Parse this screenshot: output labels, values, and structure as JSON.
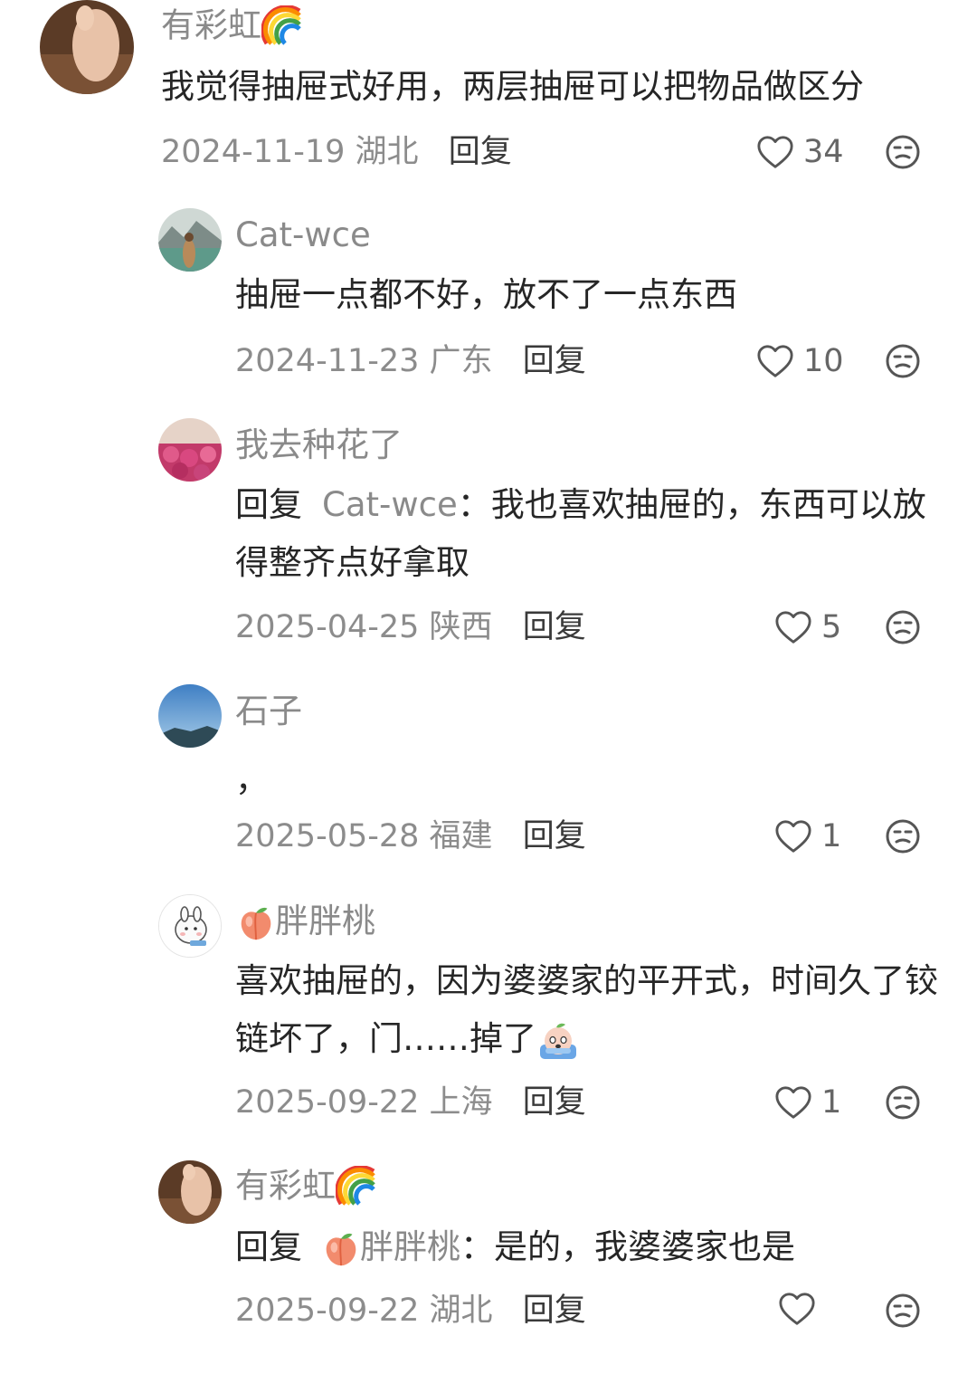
{
  "comments": [
    {
      "name": "有彩虹",
      "name_emoji": "rainbow-icon",
      "text": "我觉得抽屉式好用，两层抽屉可以把物品做区分",
      "date": "2024-11-19",
      "region": "湖北",
      "reply_label": "回复",
      "likes": "34"
    },
    {
      "name": "Cat-wce",
      "text": "抽屉一点都不好，放不了一点东西",
      "date": "2024-11-23",
      "region": "广东",
      "reply_label": "回复",
      "likes": "10"
    },
    {
      "name": "我去种花了",
      "reply_prefix": "回复",
      "mention": "Cat-wce",
      "text": "：我也喜欢抽屉的，东西可以放得整齐点好拿取",
      "date": "2025-04-25",
      "region": "陕西",
      "reply_label": "回复",
      "likes": "5"
    },
    {
      "name": "石子",
      "text": "，",
      "date": "2025-05-28",
      "region": "福建",
      "reply_label": "回复",
      "likes": "1"
    },
    {
      "name": "胖胖桃",
      "name_emoji": "peach-icon",
      "text": "喜欢抽屉的，因为婆婆家的平开式，时间久了铰链坏了，门……掉了",
      "text_emoji": "crying-emoji-icon",
      "date": "2025-09-22",
      "region": "上海",
      "reply_label": "回复",
      "likes": "1"
    },
    {
      "name": "有彩虹",
      "name_emoji": "rainbow-icon",
      "reply_prefix": "回复",
      "mention": "胖胖桃",
      "mention_emoji": "peach-icon",
      "text": "：是的，我婆婆家也是",
      "date": "2025-09-22",
      "region": "湖北",
      "reply_label": "回复",
      "likes": ""
    }
  ]
}
